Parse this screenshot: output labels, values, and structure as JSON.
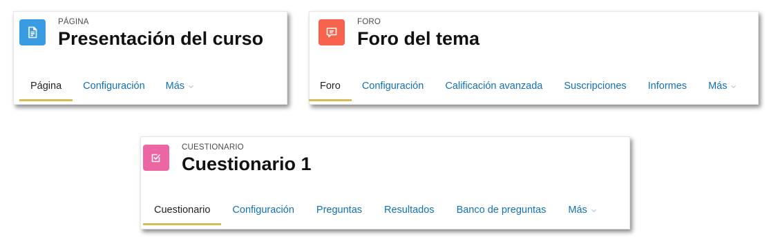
{
  "colors": {
    "pagina_icon_bg": "#399be2",
    "foro_icon_bg": "#f7634d",
    "cuestionario_icon_bg": "#eb66a2",
    "link": "#1170b8",
    "active_underline": "#d7bc56"
  },
  "cards": {
    "pagina": {
      "icon": "document-icon",
      "kind": "PÁGINA",
      "title": "Presentación del curso",
      "tabs": [
        "Página",
        "Configuración",
        "Más"
      ],
      "active_tab": "Página"
    },
    "foro": {
      "icon": "forum-icon",
      "kind": "FORO",
      "title": "Foro del tema",
      "tabs": [
        "Foro",
        "Configuración",
        "Calificación avanzada",
        "Suscripciones",
        "Informes",
        "Más"
      ],
      "active_tab": "Foro"
    },
    "cuestionario": {
      "icon": "quiz-icon",
      "kind": "CUESTIONARIO",
      "title": "Cuestionario 1",
      "tabs": [
        "Cuestionario",
        "Configuración",
        "Preguntas",
        "Resultados",
        "Banco de preguntas",
        "Más"
      ],
      "active_tab": "Cuestionario"
    }
  }
}
